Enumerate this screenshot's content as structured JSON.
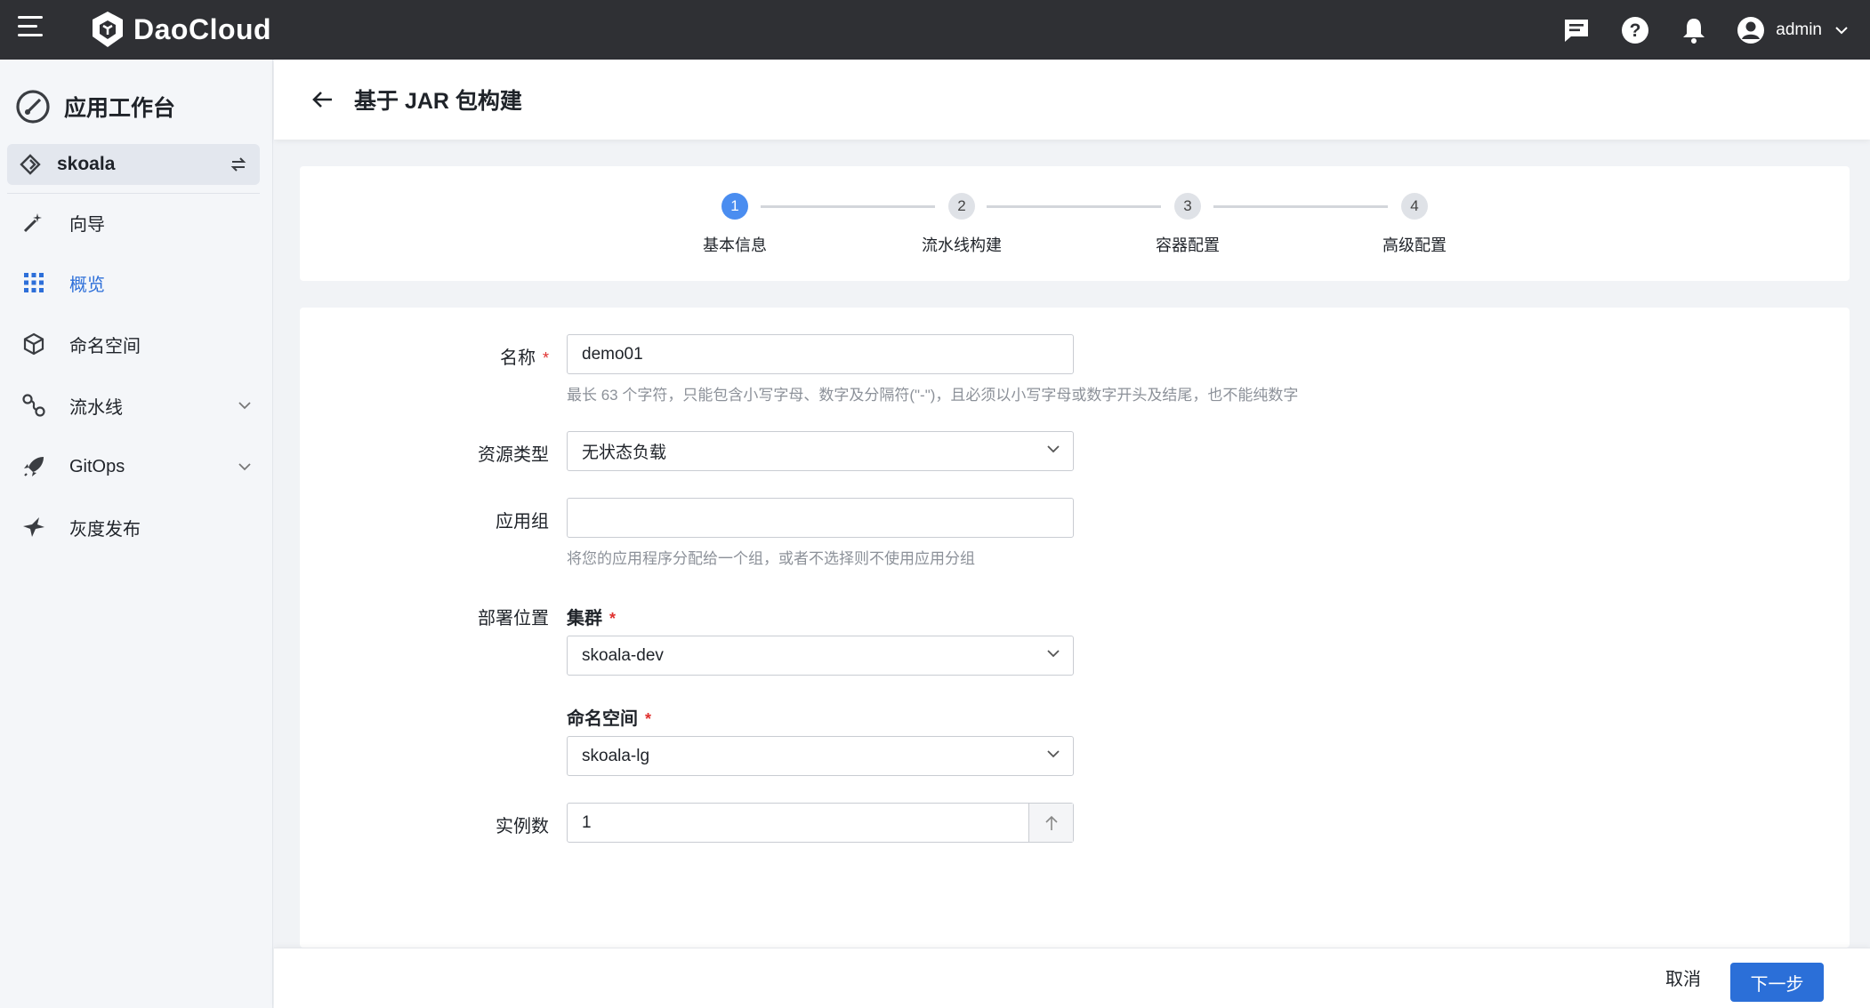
{
  "header": {
    "brand": "DaoCloud",
    "user": "admin",
    "icons": [
      "menu-icon",
      "logo-icon",
      "message-icon",
      "help-icon",
      "bell-icon",
      "user-avatar-icon",
      "chevron-down-icon"
    ]
  },
  "sidebar": {
    "app_title": "应用工作台",
    "workspace": "skoala",
    "items": [
      {
        "label": "向导",
        "icon": "wand-icon"
      },
      {
        "label": "概览",
        "icon": "grid-icon"
      },
      {
        "label": "命名空间",
        "icon": "cube-icon"
      },
      {
        "label": "流水线",
        "icon": "pipeline-icon"
      },
      {
        "label": "GitOps",
        "icon": "rocket-icon"
      },
      {
        "label": "灰度发布",
        "icon": "bird-icon"
      }
    ],
    "active_item": "概览"
  },
  "page": {
    "title": "基于 JAR 包构建"
  },
  "steps": [
    {
      "num": "1",
      "title": "基本信息"
    },
    {
      "num": "2",
      "title": "流水线构建"
    },
    {
      "num": "3",
      "title": "容器配置"
    },
    {
      "num": "4",
      "title": "高级配置"
    }
  ],
  "form": {
    "name": {
      "label": "名称",
      "required": "*",
      "value": "demo01",
      "hint": "最长 63 个字符，只能包含小写字母、数字及分隔符(\"-\")，且必须以小写字母或数字开头及结尾，也不能纯数字"
    },
    "resource_type": {
      "label": "资源类型",
      "value": "无状态负载"
    },
    "app_group": {
      "label": "应用组",
      "value": "",
      "hint": "将您的应用程序分配给一个组，或者不选择则不使用应用分组"
    },
    "deploy": {
      "label": "部署位置",
      "cluster_label": "集群",
      "cluster_value": "skoala-dev",
      "namespace_label": "命名空间",
      "namespace_value": "skoala-lg",
      "required": "*"
    },
    "replicas": {
      "label": "实例数",
      "value": "1"
    }
  },
  "footer": {
    "cancel": "取消",
    "next": "下一步"
  },
  "colors": {
    "topbar": "#2f3034",
    "accent": "#2b6fd8",
    "active_step": "#4a8df0",
    "required": "#e0312f"
  }
}
